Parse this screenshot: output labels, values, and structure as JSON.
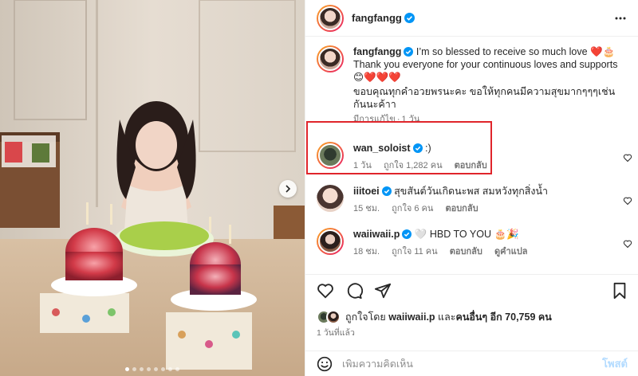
{
  "post": {
    "username": "fangfangg",
    "image_count": 8,
    "active_image": 1
  },
  "comments": [
    {
      "username": "fangfangg",
      "text": "I’m so blessed to receive so much love ❤️🎂 Thank you everyone for your continuous loves and supports 😊❤️❤️❤️",
      "text2": "ขอบคุณทุกคำอวยพรนะคะ ขอให้ทุกคนมีความสุขมากๆๆๆเช่นกันนะค้าา",
      "meta_edited": "มีการแก้ไข",
      "meta_time": "1 วัน"
    },
    {
      "username": "wan_soloist",
      "text": ":)",
      "time": "1 วัน",
      "likes": "ถูกใจ 1,282 คน",
      "reply": "ตอบกลับ",
      "highlighted": true
    },
    {
      "username": "iiitoei",
      "text": "สุขสันต์วันเกิดนะพส สมหวังทุกสิ่งน้ำ",
      "time": "15 ชม.",
      "likes": "ถูกใจ 6 คน",
      "reply": "ตอบกลับ"
    },
    {
      "username": "waiiwaii.p",
      "text": "🤍 HBD TO YOU 🎂🎉",
      "time": "18 ชม.",
      "likes": "ถูกใจ 11 คน",
      "reply": "ตอบกลับ",
      "translate": "ดูคำแปล"
    }
  ],
  "likes_summary": {
    "prefix": "ถูกใจโดย ",
    "first_user": "waiiwaii.p",
    "middle": " และ",
    "others": "คนอื่นๆ อีก 70,759 คน"
  },
  "posted_time": "1 วันที่แล้ว",
  "add_comment": {
    "placeholder": "เพิ่มความคิดเห็น",
    "post_label": "โพสต์"
  },
  "colors": {
    "verified": "#0095f6",
    "highlight_box": "#e0252b",
    "post_button_disabled": "#b3dbff"
  },
  "icons": [
    "more-options-icon",
    "heart-icon",
    "comment-icon",
    "share-icon",
    "bookmark-icon",
    "emoji-icon",
    "verified-icon",
    "chevron-right-icon"
  ]
}
